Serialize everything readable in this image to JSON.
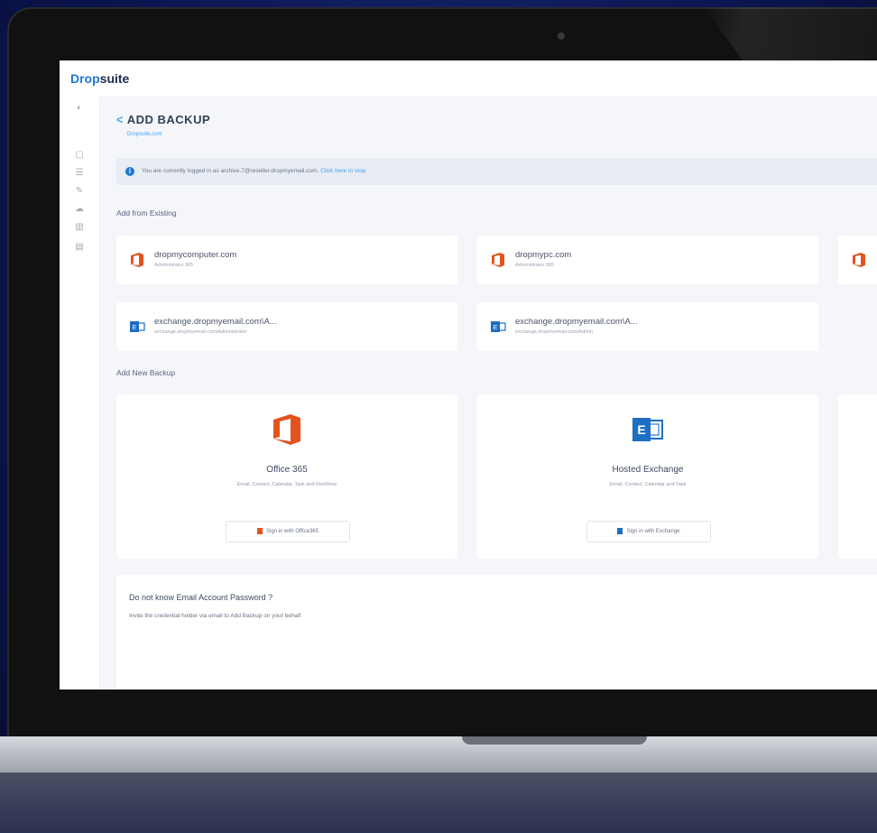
{
  "brand": {
    "part1": "Drop",
    "part2": "suite"
  },
  "sidebar": {
    "items": [
      {
        "icon": "toggle-icon"
      },
      {
        "icon": "home-icon"
      },
      {
        "icon": "list-icon"
      },
      {
        "icon": "attachment-icon"
      },
      {
        "icon": "cloud-icon"
      },
      {
        "icon": "chart-icon"
      },
      {
        "icon": "document-icon"
      }
    ]
  },
  "header": {
    "back_glyph": "<",
    "title": "ADD BACKUP",
    "subtitle": "Dropsuite.com"
  },
  "info_bar": {
    "text": "You are currently logged in as archive.7@reseller.dropmyemail.com.",
    "link": "Click here to stop"
  },
  "sections": {
    "existing": "Add from Existing",
    "new": "Add New Backup"
  },
  "existing_accounts": [
    {
      "name": "dropmycomputer.com",
      "sub": "Administrator 365",
      "type": "office365"
    },
    {
      "name": "dropmypc.com",
      "sub": "Administrator 365",
      "type": "office365"
    },
    {
      "name": "exchange.dropmyemail.com\\A...",
      "sub": "exchange.dropmyemail.com\\Administrator",
      "type": "exchange"
    },
    {
      "name": "exchange.dropmyemail.com\\A...",
      "sub": "exchange.dropmyemail.com\\Admin",
      "type": "exchange"
    }
  ],
  "new_backup": [
    {
      "title": "Office 365",
      "desc": "Email, Contact, Calendar, Task and OneDrive",
      "button": "Sign in with Office365"
    },
    {
      "title": "Hosted Exchange",
      "desc": "Email, Contact, Calendar and Task",
      "button": "Sign in with Exchange"
    }
  ],
  "password_help": {
    "title": "Do not know Email Account Password ?",
    "text": "Invite the credential holder via email to Add Backup on your behalf"
  },
  "colors": {
    "office_orange": "#e2531f",
    "exchange_blue": "#1d6fc4",
    "accent": "#1f78d6"
  }
}
